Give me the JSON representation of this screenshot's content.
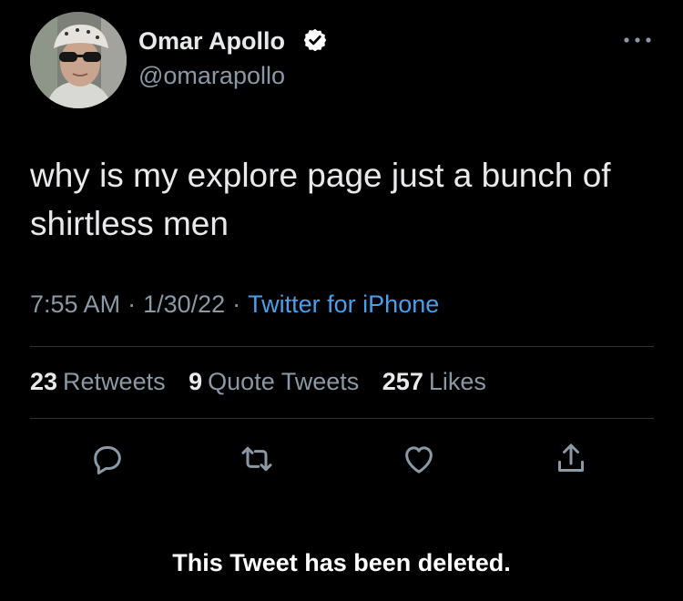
{
  "author": {
    "name": "Omar Apollo",
    "handle": "@omarapollo"
  },
  "tweet": {
    "text": "why is my explore page just a bunch of shirtless men",
    "time": "7:55 AM",
    "date": "1/30/22",
    "source": "Twitter for iPhone",
    "separator": "·"
  },
  "stats": {
    "retweets": {
      "count": "23",
      "label": "Retweets"
    },
    "quote_tweets": {
      "count": "9",
      "label": "Quote Tweets"
    },
    "likes": {
      "count": "257",
      "label": "Likes"
    }
  },
  "actions": [
    "reply-icon",
    "retweet-icon",
    "like-icon",
    "share-icon"
  ],
  "notice": "This Tweet has been deleted.",
  "colors": {
    "background": "#000000",
    "primary_text": "#e7e9ea",
    "secondary_text": "#8b98a5",
    "link": "#4a9fe8",
    "verified": "#ffffff"
  }
}
